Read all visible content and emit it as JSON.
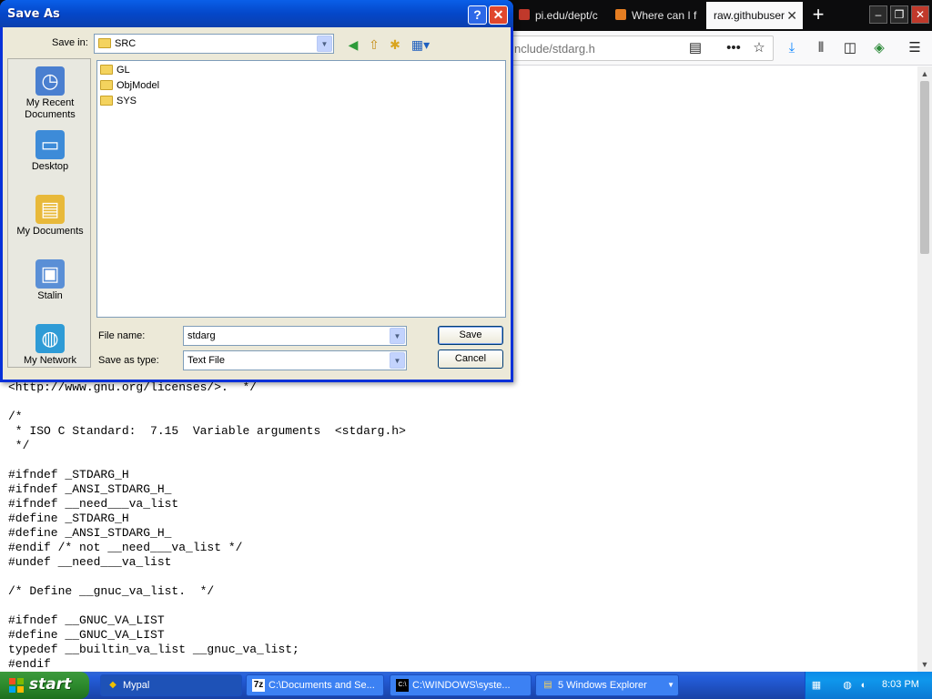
{
  "browser": {
    "tabs": [
      {
        "label": "pi.edu/dept/c",
        "favicon_color": "#c0392b"
      },
      {
        "label": "Where can I f",
        "favicon_color": "#e67e22"
      },
      {
        "label": "raw.githubuser",
        "favicon_color": "#ffffff"
      }
    ],
    "new_tab_glyph": "+",
    "window_controls": {
      "minimize": "‒",
      "restore": "❐",
      "close": "✕"
    },
    "url": "nclude/stdarg.h",
    "toolbar_icons": [
      "reader-view-icon",
      "page-actions-icon",
      "bookmark-star-icon",
      "downloads-icon",
      "library-icon",
      "sidebar-icon",
      "extension-icon",
      "menu-icon"
    ],
    "code_text": "<http://www.gnu.org/licenses/>.  */\n\n/*\n * ISO C Standard:  7.15  Variable arguments  <stdarg.h>\n */\n\n#ifndef _STDARG_H\n#ifndef _ANSI_STDARG_H_\n#ifndef __need___va_list\n#define _STDARG_H\n#define _ANSI_STDARG_H_\n#endif /* not __need___va_list */\n#undef __need___va_list\n\n/* Define __gnuc_va_list.  */\n\n#ifndef __GNUC_VA_LIST\n#define __GNUC_VA_LIST\ntypedef __builtin_va_list __gnuc_va_list;\n#endif"
  },
  "dialog": {
    "title": "Save As",
    "help_glyph": "?",
    "close_glyph": "✕",
    "save_in_label": "Save in:",
    "save_in_value": "SRC",
    "places": [
      {
        "label": "My Recent Documents",
        "color": "#4a7fd0",
        "glyph": "◷"
      },
      {
        "label": "Desktop",
        "color": "#3d8bd8",
        "glyph": "▭"
      },
      {
        "label": "My Documents",
        "color": "#e8b93a",
        "glyph": "▤"
      },
      {
        "label": "Stalin",
        "color": "#5a8fd6",
        "glyph": "▣"
      },
      {
        "label": "My Network",
        "color": "#2e9bd6",
        "glyph": "◍"
      }
    ],
    "files": [
      "GL",
      "ObjModel",
      "SYS"
    ],
    "file_name_label": "File name:",
    "file_name_value": "stdarg",
    "save_type_label": "Save as type:",
    "save_type_value": "Text File",
    "save_button": "Save",
    "cancel_button": "Cancel"
  },
  "taskbar": {
    "start_label": "start",
    "tasks": [
      {
        "label": "Mypal",
        "icon": "◆",
        "active": true
      },
      {
        "label": "C:\\Documents and Se...",
        "icon": "7z",
        "active": false
      },
      {
        "label": "C:\\WINDOWS\\syste...",
        "icon": "C:\\",
        "active": false
      },
      {
        "label": "5 Windows Explorer",
        "icon": "▤",
        "active": false
      }
    ],
    "clock": "8:03 PM"
  }
}
